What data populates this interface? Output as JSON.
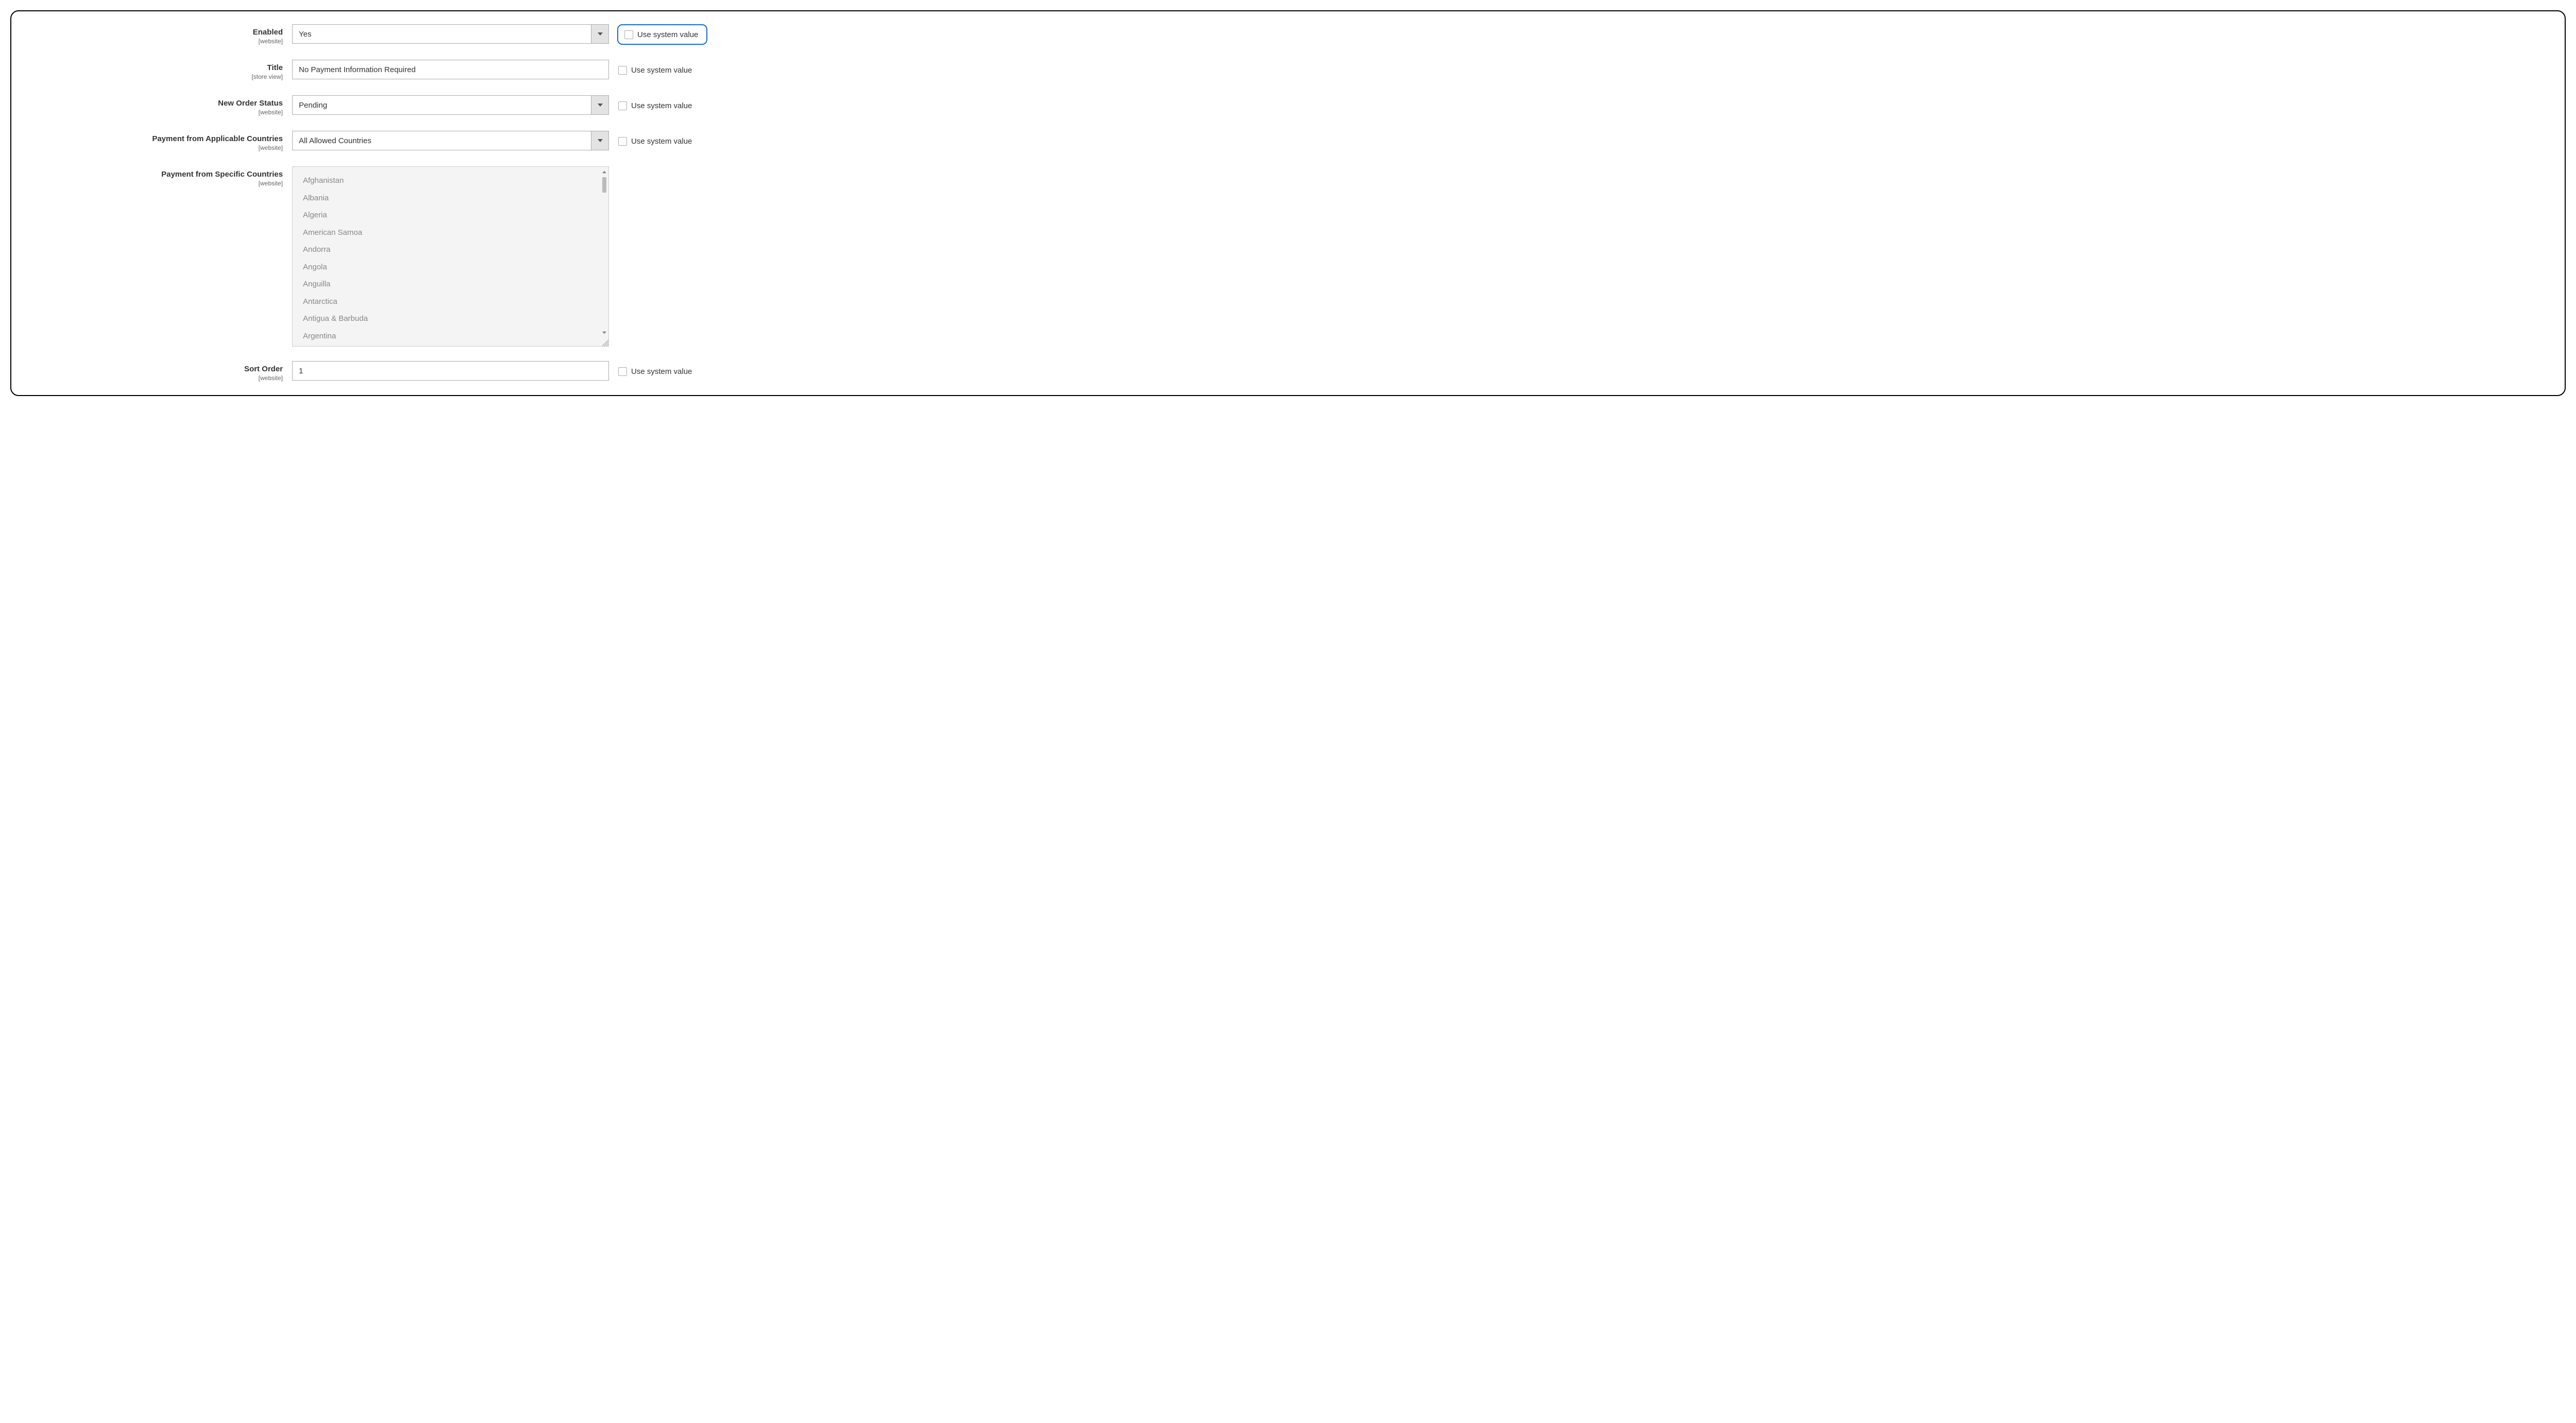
{
  "fields": {
    "enabled": {
      "label": "Enabled",
      "scope": "[website]",
      "value": "Yes",
      "use_system_label": "Use system value"
    },
    "title": {
      "label": "Title",
      "scope": "[store view]",
      "value": "No Payment Information Required",
      "use_system_label": "Use system value"
    },
    "new_order_status": {
      "label": "New Order Status",
      "scope": "[website]",
      "value": "Pending",
      "use_system_label": "Use system value"
    },
    "applicable_countries": {
      "label": "Payment from Applicable Countries",
      "scope": "[website]",
      "value": "All Allowed Countries",
      "use_system_label": "Use system value"
    },
    "specific_countries": {
      "label": "Payment from Specific Countries",
      "scope": "[website]",
      "options": [
        "Afghanistan",
        "Albania",
        "Algeria",
        "American Samoa",
        "Andorra",
        "Angola",
        "Anguilla",
        "Antarctica",
        "Antigua & Barbuda",
        "Argentina"
      ]
    },
    "sort_order": {
      "label": "Sort Order",
      "scope": "[website]",
      "value": "1",
      "use_system_label": "Use system value"
    }
  }
}
